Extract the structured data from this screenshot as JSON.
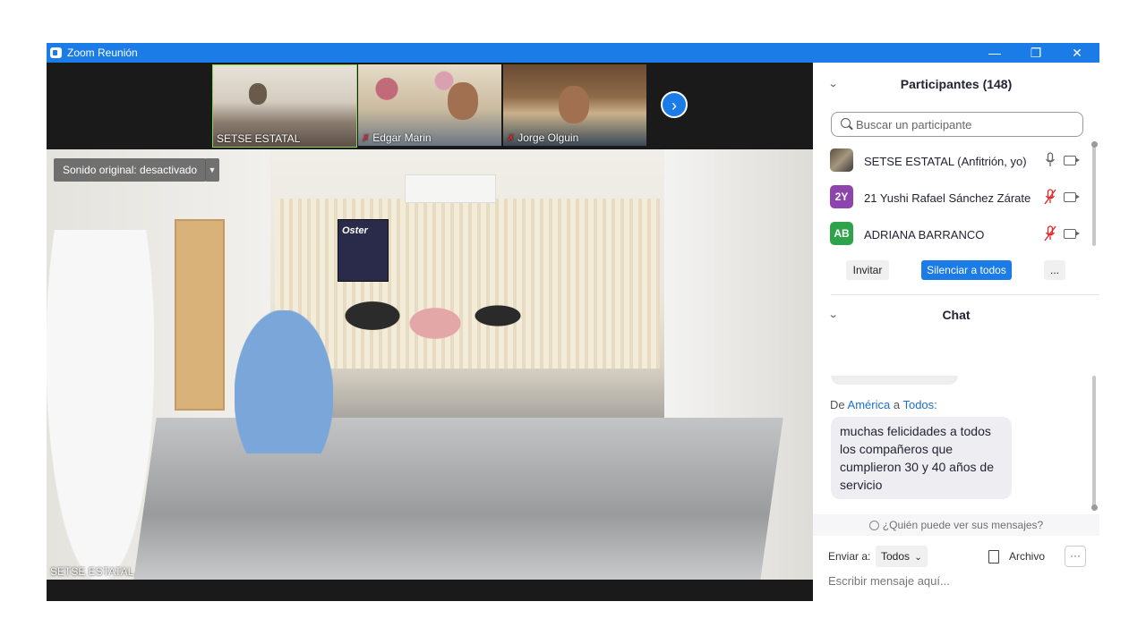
{
  "window": {
    "title": "Zoom Reunión",
    "minimize": "—",
    "maximize": "❐",
    "close": "✕"
  },
  "video": {
    "thumbnails": [
      {
        "name": "SETSE ESTATAL",
        "muted": false
      },
      {
        "name": "Edgar Marin",
        "muted": true
      },
      {
        "name": "Jorge Olguin",
        "muted": true
      }
    ],
    "next_icon": "chevron-right",
    "sound_button": "Sonido original: desactivado",
    "main_speaker": "SETSE ESTATAL",
    "scene_box_text": "Oster"
  },
  "participants": {
    "header": "Participantes (148)",
    "search_placeholder": "Buscar un participante",
    "list": [
      {
        "initials": "",
        "name": "SETSE ESTATAL (Anfitrión, yo)",
        "mic": "on",
        "avatar_color": "#6d6050"
      },
      {
        "initials": "2Y",
        "name": "21 Yushi Rafael Sánchez Zárate",
        "mic": "muted",
        "avatar_color": "#8e44ad"
      },
      {
        "initials": "AB",
        "name": "ADRIANA BARRANCO",
        "mic": "muted",
        "avatar_color": "#2fa34a"
      }
    ],
    "invite_button": "Invitar",
    "mute_all_button": "Silenciar a todos",
    "more_button": "..."
  },
  "chat": {
    "header": "Chat",
    "from_prefix": "De",
    "sender": "América",
    "to_word": "a",
    "recipient": "Todos:",
    "message": "muchas felicidades a todos los compañeros que cumplieron 30 y 40 años de servicio",
    "who_can_see": "¿Quién puede ver sus mensajes?",
    "send_to_label": "Enviar a:",
    "send_to_value": "Todos",
    "file_label": "Archivo",
    "more_label": "···",
    "input_placeholder": "Escribir mensaje aquí..."
  },
  "colors": {
    "accent": "#1b7be7",
    "muted_red": "#e02828"
  }
}
